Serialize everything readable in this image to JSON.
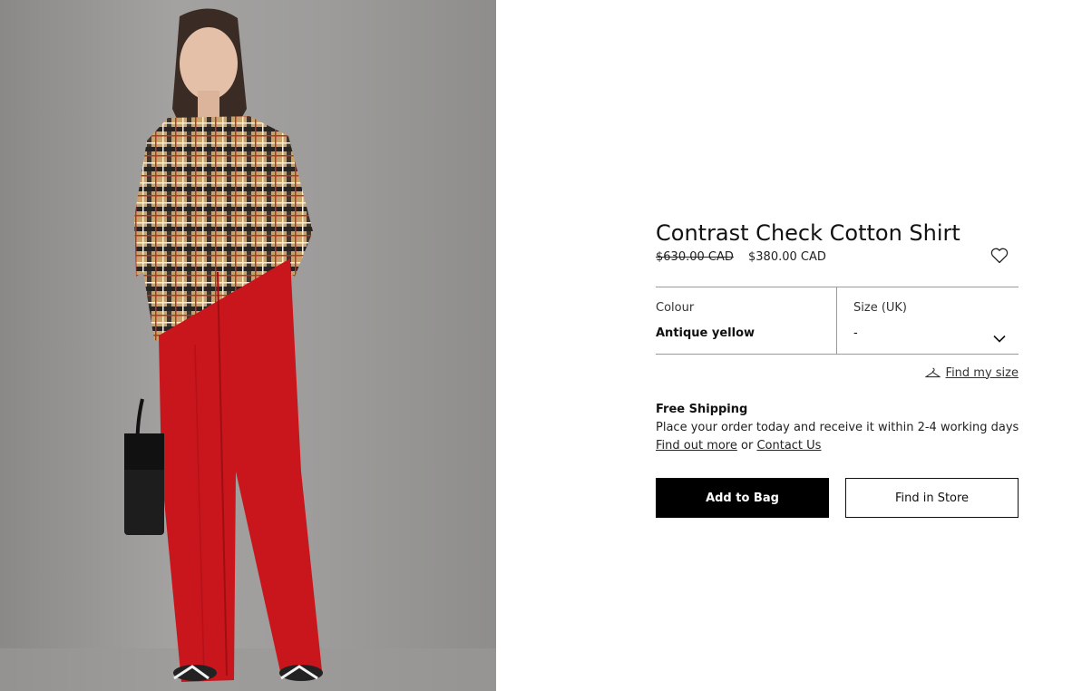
{
  "product": {
    "title": "Contrast Check Cotton Shirt",
    "price_original": "$630.00 CAD",
    "price_sale": "$380.00 CAD"
  },
  "selector": {
    "colour_label": "Colour",
    "colour_value": "Antique yellow",
    "size_label": "Size (UK)",
    "size_value": "-"
  },
  "find_size": {
    "label": "Find my size",
    "icon": "hanger-icon"
  },
  "shipping": {
    "title": "Free Shipping",
    "text": "Place your order today and receive it within 2-4 working days",
    "link_more": "Find out more",
    "or_text": " or ",
    "link_contact": "Contact Us"
  },
  "buttons": {
    "add_to_bag": "Add to Bag",
    "find_in_store": "Find in Store"
  },
  "icons": {
    "wishlist": "heart-icon",
    "size_dropdown": "chevron-down-icon"
  },
  "colors": {
    "primary_button": "#000000",
    "divider": "#9a9a9a"
  }
}
